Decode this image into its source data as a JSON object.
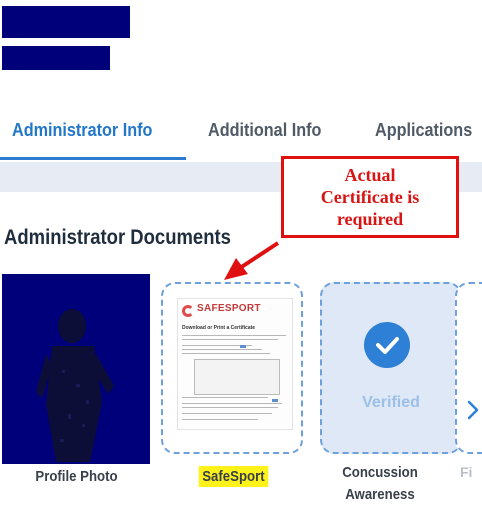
{
  "redaction_color": "#00007a",
  "tabs": [
    {
      "label": "Administrator Info",
      "active": true
    },
    {
      "label": "Additional Info",
      "active": false
    },
    {
      "label": "Applications",
      "active": false
    }
  ],
  "section_title": "Administrator Documents",
  "callout": {
    "line1": "Actual",
    "line2": "Certificate is",
    "line3": "required",
    "color": "#d91414"
  },
  "documents": [
    {
      "label": "Profile Photo"
    },
    {
      "label": "SafeSport",
      "highlighted": true,
      "preview": {
        "brand": "SAFESPORT",
        "heading": "Download or Print a Certificate"
      }
    },
    {
      "label_line1": "Concussion",
      "label_line2": "Awareness",
      "status": "Verified",
      "status_icon": "check-icon"
    },
    {
      "label": "Fi"
    }
  ],
  "next_icon": "chevron-right-icon",
  "accent": "#2e7fd6"
}
